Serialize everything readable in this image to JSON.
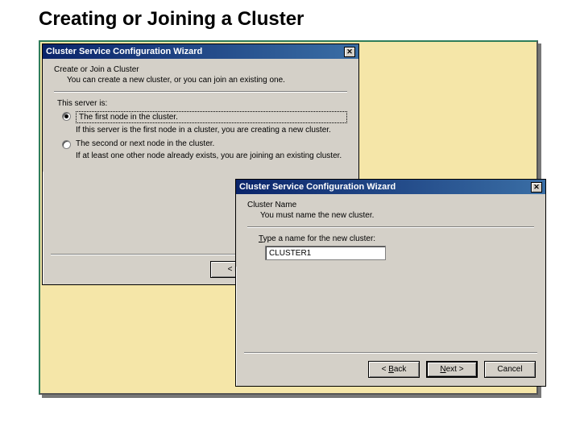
{
  "slide": {
    "title": "Creating or Joining a Cluster"
  },
  "dialog1": {
    "title": "Cluster Service Configuration Wizard",
    "heading": "Create or Join a Cluster",
    "subheading": "You can create a new cluster, or you can join an existing one.",
    "section_label": "This server is:",
    "option1_label": "The first node in the cluster.",
    "option1_help": "If this server is the first node in a cluster, you are creating a new cluster.",
    "option2_label": "The second or next node in the cluster.",
    "option2_help": "If at least one other node already exists, you are joining an existing cluster.",
    "back_label": "< Ba"
  },
  "dialog2": {
    "title": "Cluster Service Configuration Wizard",
    "heading": "Cluster Name",
    "subheading": "You must name the new cluster.",
    "input_label_pre": "T",
    "input_label_rest": "ype a name for the new cluster:",
    "input_value": "CLUSTER1",
    "back_label_pre": "< ",
    "back_label_ul": "B",
    "back_label_post": "ack",
    "next_label_ul": "N",
    "next_label_post": "ext >",
    "cancel_label": "Cancel"
  }
}
